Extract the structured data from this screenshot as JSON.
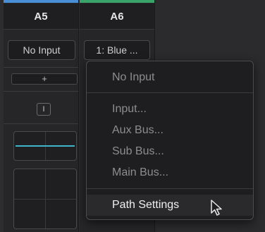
{
  "tracks": [
    {
      "name": "A5",
      "input_label": "No Input",
      "color": "#4a8fd6"
    },
    {
      "name": "A6",
      "input_label": "1: Blue ...",
      "color": "#3aa36a"
    }
  ],
  "controls": {
    "add_label": "+",
    "small_box_label": "I"
  },
  "menu": {
    "items": [
      {
        "label": "No Input"
      },
      {
        "label": "Input..."
      },
      {
        "label": "Aux Bus..."
      },
      {
        "label": "Sub Bus..."
      },
      {
        "label": "Main Bus..."
      },
      {
        "label": "Path Settings"
      }
    ]
  },
  "colors": {
    "eq_curve": "#3fb4cc"
  }
}
